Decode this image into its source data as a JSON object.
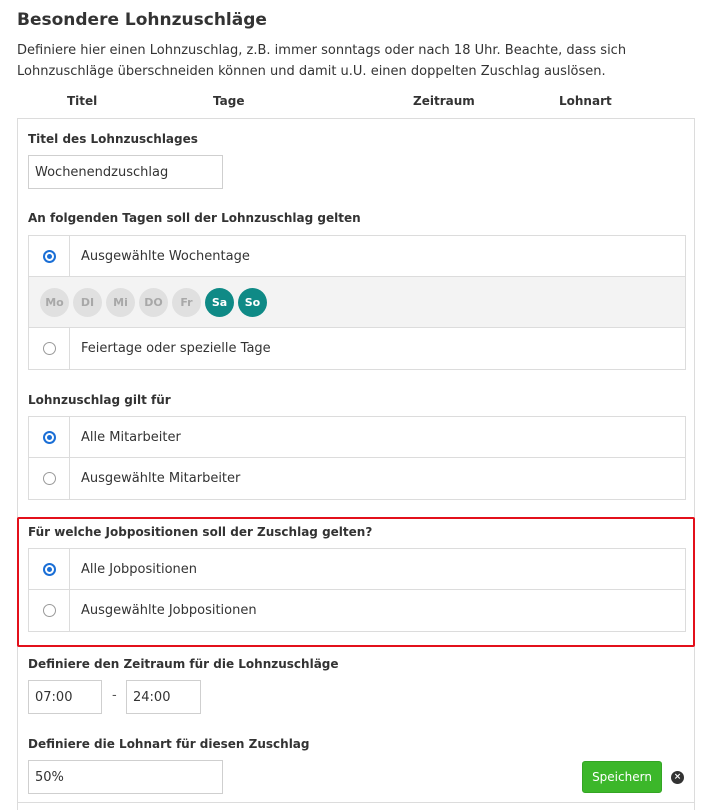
{
  "page": {
    "title": "Besondere Lohnzuschläge",
    "intro": "Definiere hier einen Lohnzuschlag, z.B. immer sonntags oder nach 18 Uhr. Beachte, dass sich Lohnzuschläge überschneiden können und damit u.U. einen doppelten Zuschlag auslösen."
  },
  "columns": [
    "Titel",
    "Tage",
    "Zeitraum",
    "Lohnart"
  ],
  "form": {
    "title_label": "Titel des Lohnzuschlages",
    "title_value": "Wochenendzuschlag",
    "days_label": "An folgenden Tagen soll der Lohnzuschlag gelten",
    "days_options": [
      {
        "label": "Ausgewählte Wochentage",
        "checked": true
      },
      {
        "label": "Feiertage oder spezielle Tage",
        "checked": false
      }
    ],
    "weekdays": [
      {
        "label": "Mo",
        "active": false
      },
      {
        "label": "DI",
        "active": false
      },
      {
        "label": "Mi",
        "active": false
      },
      {
        "label": "DO",
        "active": false
      },
      {
        "label": "Fr",
        "active": false
      },
      {
        "label": "Sa",
        "active": true
      },
      {
        "label": "So",
        "active": true
      }
    ],
    "employees_label": "Lohnzuschlag gilt für",
    "employees_options": [
      {
        "label": "Alle Mitarbeiter",
        "checked": true
      },
      {
        "label": "Ausgewählte Mitarbeiter",
        "checked": false
      }
    ],
    "jobs_label": "Für welche Jobpositionen soll der Zuschlag gelten?",
    "jobs_options": [
      {
        "label": "Alle Jobpositionen",
        "checked": true
      },
      {
        "label": "Ausgewählte Jobpositionen",
        "checked": false
      }
    ],
    "period_label": "Definiere den Zeitraum für die Lohnzuschläge",
    "period_from": "07:00",
    "period_separator": "-",
    "period_to": "24:00",
    "wage_label": "Definiere die Lohnart für diesen Zuschlag",
    "wage_value": "50%",
    "save_label": "Speichern",
    "close_symbol": "×"
  },
  "colors": {
    "accent_radio": "#1b6fd6",
    "day_active": "#0f8a86",
    "save_button": "#3cb72a",
    "highlight_border": "#e3101b"
  }
}
